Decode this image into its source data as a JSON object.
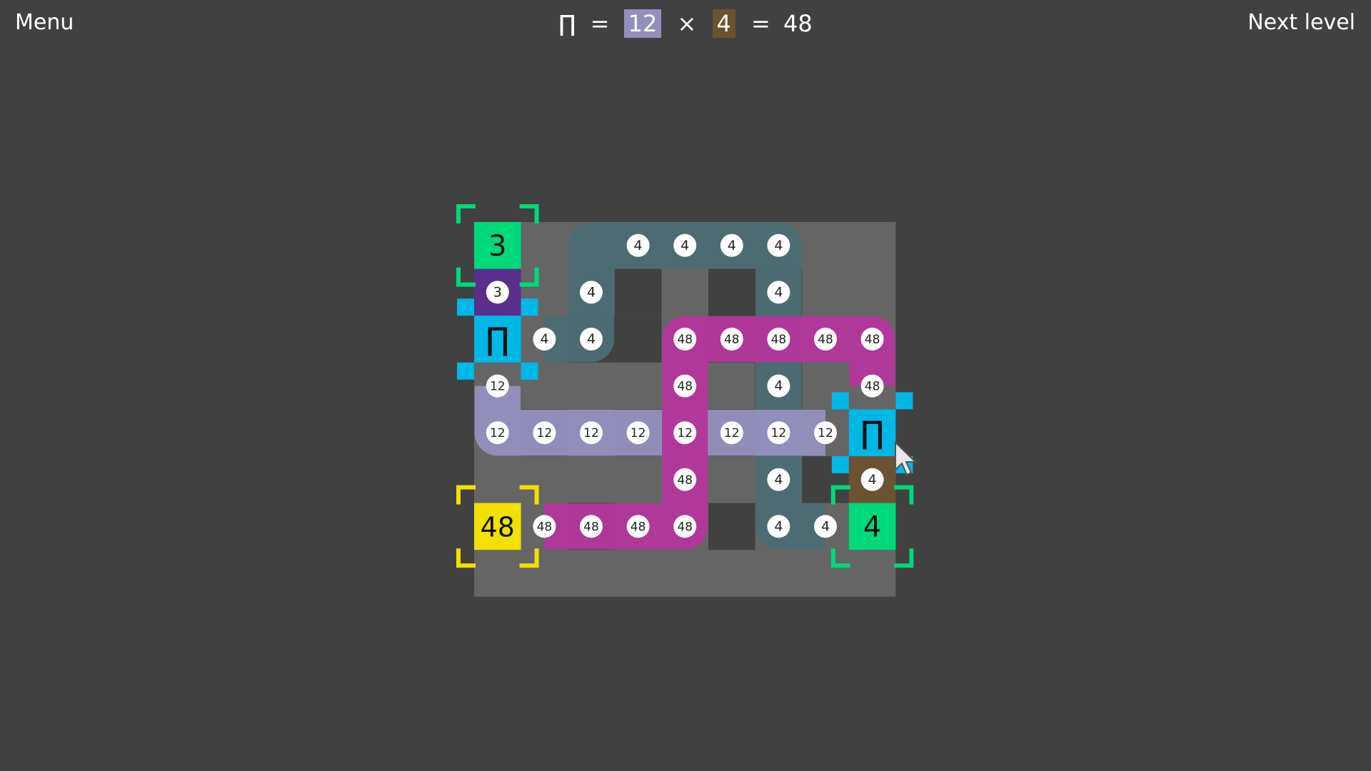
{
  "header": {
    "menu_label": "Menu",
    "next_label": "Next level",
    "formula": {
      "op_symbol": "∏",
      "eq1": "=",
      "operand1": "12",
      "times": "×",
      "operand2": "4",
      "eq2": "=",
      "result": "48"
    }
  },
  "colors": {
    "background": "#414141",
    "grid": "#656565",
    "hole": "#414141",
    "path_4": "#4c6b73",
    "path_12": "#938fbd",
    "path_48": "#b2379a",
    "source": "#00d97a",
    "target": "#f2e100",
    "operator": "#00b7e6",
    "purple_cell": "#5a2e8c",
    "brown_cell": "#6b5230",
    "bracket_green": "#00d97a",
    "bracket_yellow": "#f2e100"
  },
  "board": {
    "cols": 9,
    "rows": 8,
    "holes": [
      [
        3,
        1
      ],
      [
        5,
        1
      ],
      [
        2,
        2
      ],
      [
        5,
        2
      ],
      [
        1,
        4
      ],
      [
        3,
        4
      ],
      [
        5,
        4
      ],
      [
        2,
        6
      ],
      [
        5,
        6
      ],
      [
        6,
        3
      ],
      [
        6,
        1
      ],
      [
        3,
        2
      ],
      [
        7,
        5
      ]
    ],
    "sources": [
      {
        "cell": [
          0,
          0
        ],
        "value": "3",
        "color": "#00d97a"
      },
      {
        "cell": [
          8,
          6
        ],
        "value": "4",
        "color": "#00d97a"
      }
    ],
    "target": {
      "cell": [
        0,
        6
      ],
      "value": "48"
    },
    "operators": [
      {
        "cell": [
          0,
          2
        ],
        "symbol": "∏"
      },
      {
        "cell": [
          8,
          4
        ],
        "symbol": "∏"
      }
    ],
    "special_cells": [
      {
        "cell": [
          0,
          1
        ],
        "color": "#5a2e8c",
        "value": "3"
      },
      {
        "cell": [
          8,
          5
        ],
        "color": "#6b5230",
        "value": "4"
      }
    ],
    "paths": [
      {
        "value": "4",
        "color": "#4c6b73",
        "cells": [
          [
            1,
            2
          ],
          [
            2,
            2
          ],
          [
            2,
            1
          ],
          [
            2,
            0
          ],
          [
            3,
            0
          ],
          [
            4,
            0
          ],
          [
            5,
            0
          ],
          [
            6,
            0
          ],
          [
            6,
            1
          ],
          [
            6,
            2
          ],
          [
            6,
            3
          ],
          [
            6,
            4
          ],
          [
            6,
            5
          ],
          [
            6,
            6
          ],
          [
            7,
            6
          ]
        ],
        "labels": [
          [
            1,
            2
          ],
          [
            2,
            2
          ],
          [
            2,
            1
          ],
          [
            3,
            0
          ],
          [
            4,
            0
          ],
          [
            5,
            0
          ],
          [
            6,
            0
          ],
          [
            6,
            1
          ],
          [
            6,
            3
          ],
          [
            6,
            5
          ],
          [
            6,
            6
          ],
          [
            7,
            6
          ]
        ]
      },
      {
        "value": "12",
        "color": "#938fbd",
        "cells": [
          [
            0,
            3
          ],
          [
            0,
            4
          ],
          [
            1,
            4
          ],
          [
            2,
            4
          ],
          [
            3,
            4
          ],
          [
            4,
            4
          ],
          [
            5,
            4
          ],
          [
            6,
            4
          ],
          [
            7,
            4
          ]
        ],
        "labels": [
          [
            0,
            3
          ],
          [
            0,
            4
          ],
          [
            1,
            4
          ],
          [
            2,
            4
          ],
          [
            3,
            4
          ],
          [
            4,
            4
          ],
          [
            5,
            4
          ],
          [
            6,
            4
          ],
          [
            7,
            4
          ]
        ]
      },
      {
        "value": "48",
        "color": "#b2379a",
        "cells": [
          [
            8,
            3
          ],
          [
            8,
            2
          ],
          [
            7,
            2
          ],
          [
            6,
            2
          ],
          [
            5,
            2
          ],
          [
            4,
            2
          ],
          [
            4,
            3
          ],
          [
            4,
            4
          ],
          [
            4,
            5
          ],
          [
            4,
            6
          ],
          [
            3,
            6
          ],
          [
            2,
            6
          ],
          [
            1,
            6
          ]
        ],
        "labels": [
          [
            8,
            3
          ],
          [
            8,
            2
          ],
          [
            7,
            2
          ],
          [
            6,
            2
          ],
          [
            5,
            2
          ],
          [
            4,
            2
          ],
          [
            4,
            3
          ],
          [
            4,
            5
          ],
          [
            4,
            6
          ],
          [
            3,
            6
          ],
          [
            2,
            6
          ],
          [
            1,
            6
          ]
        ]
      }
    ]
  }
}
